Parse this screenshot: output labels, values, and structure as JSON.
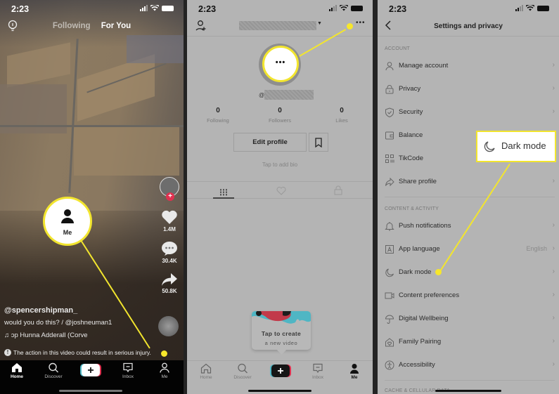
{
  "status_time": "2:23",
  "feed": {
    "tabs": [
      "Following",
      "For You"
    ],
    "active_tab": "For You",
    "username": "@spencershipman_",
    "description": "would you do this?  / @joshneuman1",
    "music": "♫  ɔp Hunna    Adderall (Corve",
    "warning": "The action in this video could result in serious injury.",
    "likes": "1.4M",
    "comments": "30.4K",
    "shares": "50.8K"
  },
  "tabbar": {
    "home": "Home",
    "discover": "Discover",
    "inbox": "Inbox",
    "me": "Me"
  },
  "callouts": {
    "me_label": "Me",
    "more_glyph": "•••",
    "dark_mode_label": "Dark mode"
  },
  "profile": {
    "at_sign": "@",
    "stats": [
      {
        "value": "0",
        "label": "Following"
      },
      {
        "value": "0",
        "label": "Followers"
      },
      {
        "value": "0",
        "label": "Likes"
      }
    ],
    "edit_profile": "Edit profile",
    "bio_placeholder": "Tap to add bio",
    "tooltip_line1": "Tap to create",
    "tooltip_line2": "a new video"
  },
  "settings": {
    "title": "Settings and privacy",
    "sections": [
      {
        "header": "ACCOUNT",
        "items": [
          {
            "icon": "person-icon",
            "label": "Manage account"
          },
          {
            "icon": "lock-icon",
            "label": "Privacy"
          },
          {
            "icon": "shield-icon",
            "label": "Security"
          },
          {
            "icon": "wallet-icon",
            "label": "Balance"
          },
          {
            "icon": "qr-code-icon",
            "label": "TikCode"
          },
          {
            "icon": "share-icon",
            "label": "Share profile"
          }
        ]
      },
      {
        "header": "CONTENT & ACTIVITY",
        "items": [
          {
            "icon": "bell-icon",
            "label": "Push notifications"
          },
          {
            "icon": "language-icon",
            "label": "App language",
            "value": "English"
          },
          {
            "icon": "moon-icon",
            "label": "Dark mode"
          },
          {
            "icon": "video-icon",
            "label": "Content preferences"
          },
          {
            "icon": "umbrella-icon",
            "label": "Digital Wellbeing"
          },
          {
            "icon": "family-icon",
            "label": "Family Pairing"
          },
          {
            "icon": "accessibility-icon",
            "label": "Accessibility"
          }
        ]
      },
      {
        "header": "CACHE & CELLULAR DATA",
        "items": []
      }
    ]
  },
  "colors": {
    "callout_yellow": "#f2e52e",
    "tiktok_red": "#e0304f",
    "tiktok_cyan": "#4fb6c4"
  }
}
